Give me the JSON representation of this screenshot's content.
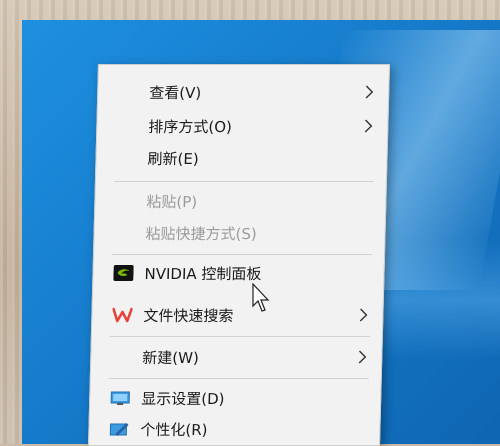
{
  "context_menu": {
    "items": [
      {
        "label": "查看(V)",
        "has_submenu": true,
        "enabled": true
      },
      {
        "label": "排序方式(O)",
        "has_submenu": true,
        "enabled": true
      },
      {
        "label": "刷新(E)",
        "has_submenu": false,
        "enabled": true
      },
      {
        "label": "粘贴(P)",
        "has_submenu": false,
        "enabled": false
      },
      {
        "label": "粘贴快捷方式(S)",
        "has_submenu": false,
        "enabled": false
      },
      {
        "label": "NVIDIA 控制面板",
        "has_submenu": false,
        "enabled": true,
        "icon": "nvidia-icon"
      },
      {
        "label": "文件快速搜索",
        "has_submenu": true,
        "enabled": true,
        "icon": "wps-icon"
      },
      {
        "label": "新建(W)",
        "has_submenu": true,
        "enabled": true
      },
      {
        "label": "显示设置(D)",
        "has_submenu": false,
        "enabled": true,
        "icon": "display-icon"
      },
      {
        "label": "个性化(R)",
        "has_submenu": false,
        "enabled": true,
        "icon": "personalize-icon"
      }
    ]
  },
  "colors": {
    "desktop_blue": "#1477c6",
    "menu_bg": "#f2f2f2",
    "disabled_text": "#9b9b9b",
    "nvidia_green": "#76b900",
    "wps_red": "#e8423b"
  }
}
